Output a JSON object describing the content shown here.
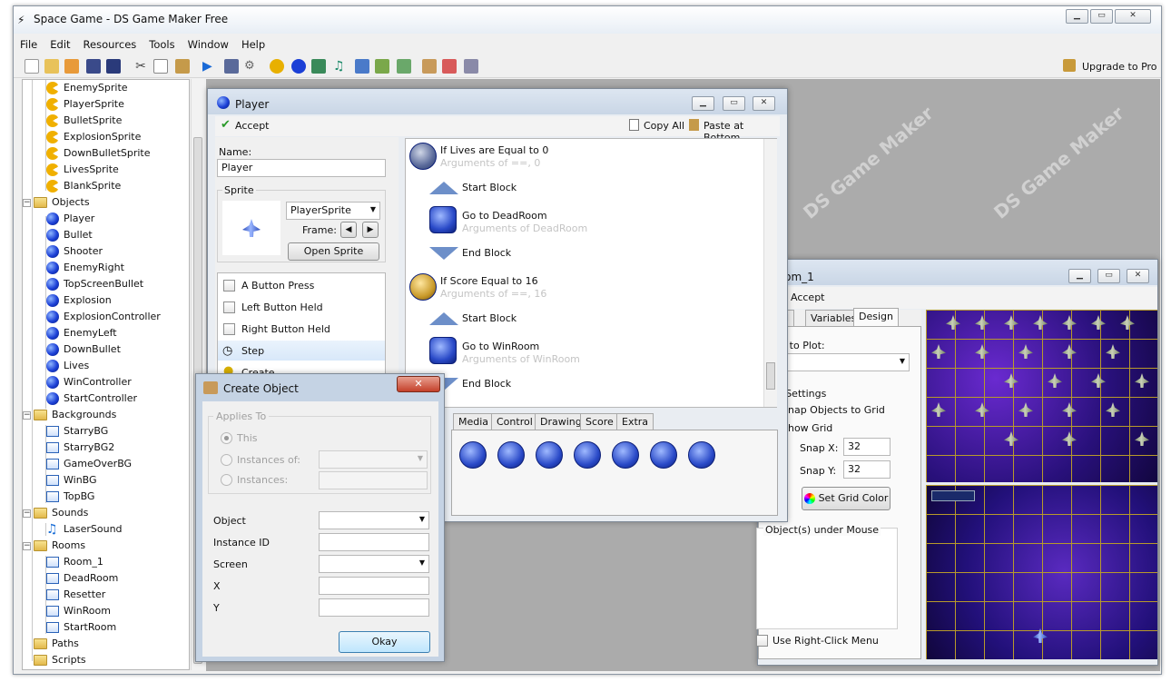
{
  "app": {
    "title": "Space Game - DS Game Maker Free",
    "upgrade_label": "Upgrade to Pro"
  },
  "menu": [
    "File",
    "Edit",
    "Resources",
    "Tools",
    "Window",
    "Help"
  ],
  "tree": {
    "sprites": [
      "EnemySprite",
      "PlayerSprite",
      "BulletSprite",
      "ExplosionSprite",
      "DownBulletSprite",
      "LivesSprite",
      "BlankSprite"
    ],
    "objects_label": "Objects",
    "objects": [
      "Player",
      "Bullet",
      "Shooter",
      "EnemyRight",
      "TopScreenBullet",
      "Explosion",
      "ExplosionController",
      "EnemyLeft",
      "DownBullet",
      "Lives",
      "WinController",
      "StartController"
    ],
    "backgrounds_label": "Backgrounds",
    "backgrounds": [
      "StarryBG",
      "StarryBG2",
      "GameOverBG",
      "WinBG",
      "TopBG"
    ],
    "sounds_label": "Sounds",
    "sounds": [
      "LaserSound"
    ],
    "rooms_label": "Rooms",
    "rooms": [
      "Room_1",
      "DeadRoom",
      "Resetter",
      "WinRoom",
      "StartRoom"
    ],
    "paths_label": "Paths",
    "scripts_label": "Scripts"
  },
  "player_window": {
    "title": "Player",
    "accept": "Accept",
    "copy_all": "Copy All",
    "paste_bottom": "Paste at Bottom",
    "name_label": "Name:",
    "name_value": "Player",
    "sprite_label": "Sprite",
    "sprite_value": "PlayerSprite",
    "frame_label": "Frame:",
    "open_sprite": "Open Sprite",
    "events": [
      "A Button Press",
      "Left Button Held",
      "Right Button Held",
      "Step",
      "Create"
    ],
    "actions": [
      {
        "title": "If Lives are Equal to 0",
        "sub": "Arguments of ==, 0"
      },
      {
        "title": "Start Block",
        "sub": ""
      },
      {
        "title": "Go to DeadRoom",
        "sub": "Arguments of DeadRoom"
      },
      {
        "title": "End Block",
        "sub": ""
      },
      {
        "title": "If Score Equal to 16",
        "sub": "Arguments of ==, 16"
      },
      {
        "title": "Start Block",
        "sub": ""
      },
      {
        "title": "Go to WinRoom",
        "sub": "Arguments of WinRoom"
      },
      {
        "title": "End Block",
        "sub": ""
      }
    ],
    "tabs": [
      "Media",
      "Control",
      "Drawing",
      "Score",
      "Extra"
    ]
  },
  "room_window": {
    "title": "Room_1",
    "accept": "Accept",
    "tabs": [
      "neral",
      "Variables",
      "Design"
    ],
    "object_to_plot": "bject to Plot:",
    "snap_settings": "nap Settings",
    "snap_objects": "Snap Objects to Grid",
    "show_grid": "Show Grid",
    "snap_x_label": "Snap X:",
    "snap_x": "32",
    "snap_y_label": "Snap Y:",
    "snap_y": "32",
    "set_grid_color": "Set Grid Color",
    "objects_under_mouse": "Object(s) under Mouse",
    "right_click_menu": "Use Right-Click Menu"
  },
  "create_object": {
    "title": "Create Object",
    "applies_to": "Applies To",
    "opt_this": "This",
    "opt_instances_of": "Instances of:",
    "opt_instances": "Instances:",
    "object_label": "Object",
    "instance_id_label": "Instance ID",
    "screen_label": "Screen",
    "x_label": "X",
    "y_label": "Y",
    "okay": "Okay"
  },
  "watermark": "DS Game Maker",
  "colors": {
    "accent": "#1b3fd6",
    "room_bg": "#3a1d8f",
    "grid": "#b89a2a"
  }
}
